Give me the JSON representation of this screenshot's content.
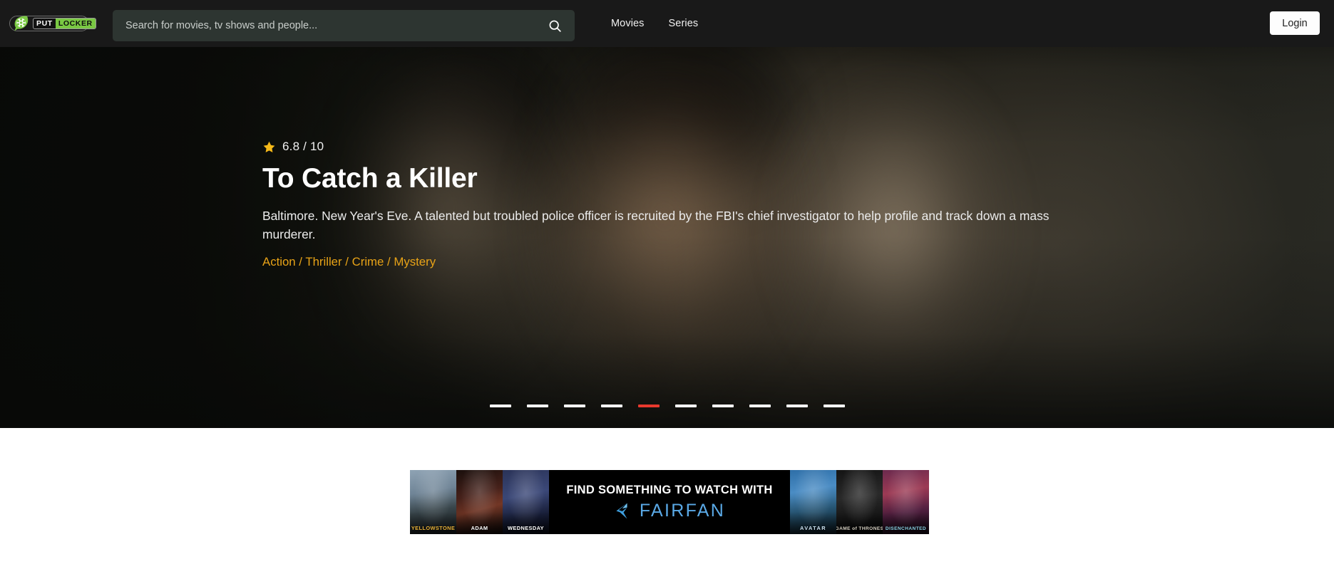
{
  "site": {
    "logo_put": "PUT",
    "logo_locker": "LOCKER",
    "logo_alt": "Putlocker"
  },
  "header": {
    "search": {
      "placeholder": "Search for movies, tv shows and people...",
      "value": "",
      "icon": "search-icon"
    },
    "nav": [
      {
        "label": "Movies"
      },
      {
        "label": "Series"
      }
    ],
    "login_label": "Login"
  },
  "hero": {
    "rating_icon": "star-icon",
    "rating": "6.8 / 10",
    "rating_value": 6.8,
    "rating_max": 10,
    "title": "To Catch a Killer",
    "description": "Baltimore. New Year's Eve. A talented but troubled police officer is recruited by the FBI's chief investigator to help profile and track down a mass murderer.",
    "genres": [
      "Action",
      "Thriller",
      "Crime",
      "Mystery"
    ],
    "genre_separator": " / ",
    "genre_color": "#e8a317",
    "carousel": {
      "count": 10,
      "active_index": 4,
      "active_color": "#e8392d",
      "inactive_color": "#ffffff"
    }
  },
  "ad": {
    "headline": "FIND SOMETHING TO WATCH WITH",
    "brand": "FAIRFAN",
    "brand_color": "#5aa9e6",
    "posters_left": [
      {
        "title": "YELLOWSTONE",
        "class": "p-yellowstone"
      },
      {
        "title": "ADAM",
        "class": "p-blackadam"
      },
      {
        "title": "WEDNESDAY",
        "class": "p-wednesday"
      }
    ],
    "posters_right": [
      {
        "title": "AVATAR",
        "class": "p-avatar"
      },
      {
        "title": "GAME of THRONES",
        "class": "p-got"
      },
      {
        "title": "DISENCHANTED",
        "class": "p-disenchanted"
      }
    ]
  }
}
